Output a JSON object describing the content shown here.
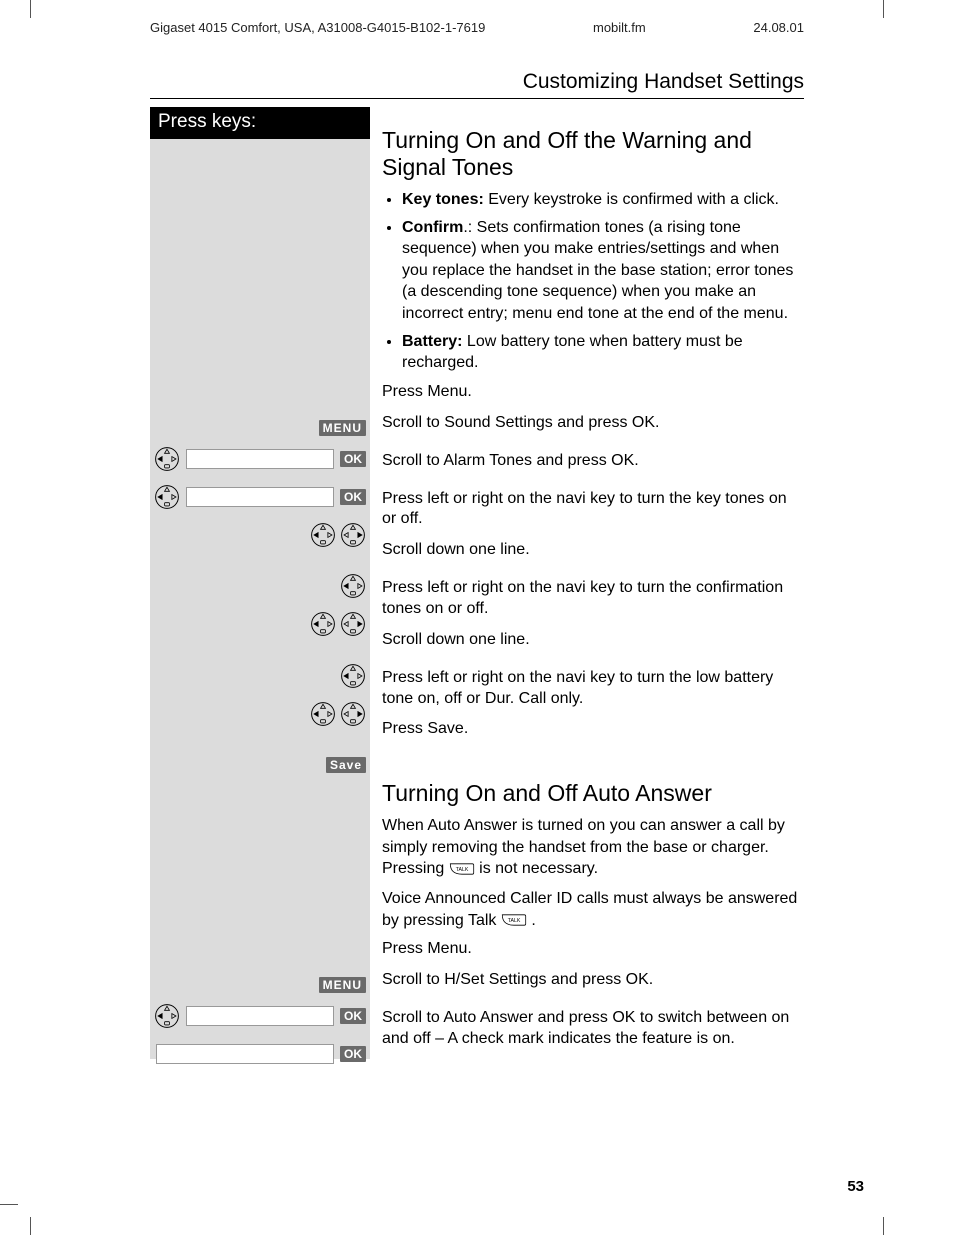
{
  "meta": {
    "doc_id": "Gigaset 4015 Comfort, USA, A31008-G4015-B102-1-7619",
    "file": "mobilt.fm",
    "date": "24.08.01"
  },
  "section_title": "Customizing Handset Settings",
  "keycol_header": "Press keys:",
  "tones": {
    "heading": "Turning On and Off the Warning and Signal Tones",
    "bullets": [
      {
        "label": "Key tones:",
        "text": " Every keystroke is confirmed with a click."
      },
      {
        "label": "Confirm",
        "text": ".: Sets confirmation tones (a rising tone sequence) when you make entries/settings and when you replace the handset in the base station; error tones (a descending tone sequence) when you make an incorrect entry; menu end tone at the end of the menu."
      },
      {
        "label": "Battery:",
        "text": " Low battery tone when battery must be recharged."
      }
    ],
    "steps": [
      {
        "key_tag": "MENU",
        "text": "Press Menu."
      },
      {
        "key_nav": true,
        "key_field": true,
        "key_ok": "OK",
        "text": "Scroll to Sound Settings and press OK."
      },
      {
        "key_nav": true,
        "key_field": true,
        "key_ok": "OK",
        "text": "Scroll to Alarm Tones and press OK."
      },
      {
        "key_lr": true,
        "text": "Press left or right on the navi key to turn the key tones on or off."
      },
      {
        "key_nav": true,
        "text": "Scroll down one line."
      },
      {
        "key_lr": true,
        "text": "Press left or right on the navi key to turn the confirmation tones on or off."
      },
      {
        "key_nav": true,
        "text": "Scroll down one line."
      },
      {
        "key_lr": true,
        "text": "Press left or right on the navi key to turn the low battery tone on, off or Dur. Call only."
      },
      {
        "key_tag": "Save",
        "text": "Press Save."
      }
    ]
  },
  "auto": {
    "heading": "Turning On and Off Auto Answer",
    "intro1a": "When Auto Answer is turned on you can answer a call by simply removing the handset from the base or charger.  Pressing ",
    "intro1b": " is not necessary.",
    "intro2a": "Voice Announced Caller ID calls must always be answered by pressing Talk ",
    "intro2b": " .",
    "talk_label": "TALK",
    "steps": [
      {
        "key_tag": "MENU",
        "text": "Press Menu."
      },
      {
        "key_nav": true,
        "key_field": true,
        "key_ok": "OK",
        "text": "Scroll to H/Set Settings and press OK."
      },
      {
        "key_field": true,
        "key_ok": "OK",
        "text": "Scroll to Auto Answer and press OK to switch between on and off – A check mark indicates the feature is on."
      }
    ]
  },
  "page_number": "53"
}
